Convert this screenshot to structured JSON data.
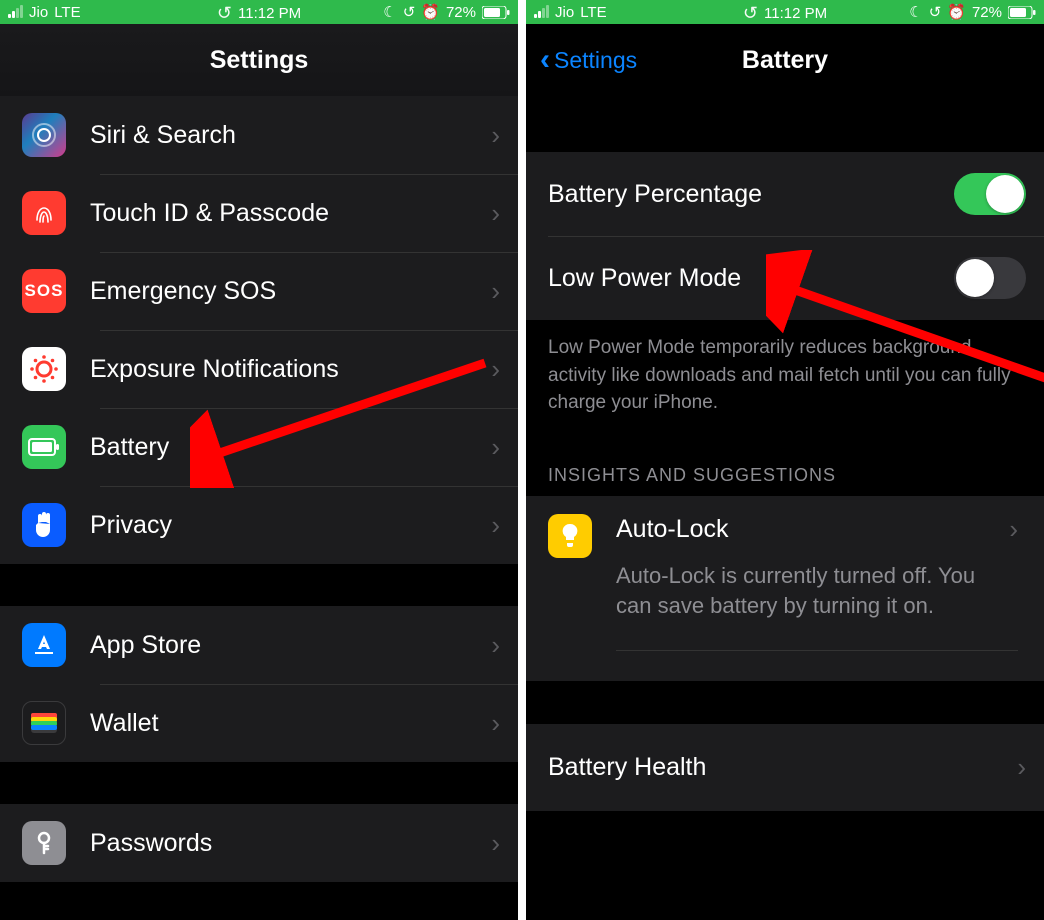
{
  "status": {
    "carrier": "Jio",
    "network": "LTE",
    "time": "11:12 PM",
    "battery_pct": "72%"
  },
  "left": {
    "title": "Settings",
    "rows": {
      "siri": "Siri & Search",
      "touch": "Touch ID & Passcode",
      "sos": "Emergency SOS",
      "expo": "Exposure Notifications",
      "batt": "Battery",
      "priv": "Privacy",
      "appstore": "App Store",
      "wallet": "Wallet",
      "pass": "Passwords"
    },
    "sos_icon_text": "SOS"
  },
  "right": {
    "back": "Settings",
    "title": "Battery",
    "battery_pct_label": "Battery Percentage",
    "low_power_label": "Low Power Mode",
    "low_power_desc": "Low Power Mode temporarily reduces background activity like downloads and mail fetch until you can fully charge your iPhone.",
    "insights_header": "INSIGHTS AND SUGGESTIONS",
    "autolock_title": "Auto-Lock",
    "autolock_desc": "Auto-Lock is currently turned off. You can save battery by turning it on.",
    "battery_health": "Battery Health"
  }
}
